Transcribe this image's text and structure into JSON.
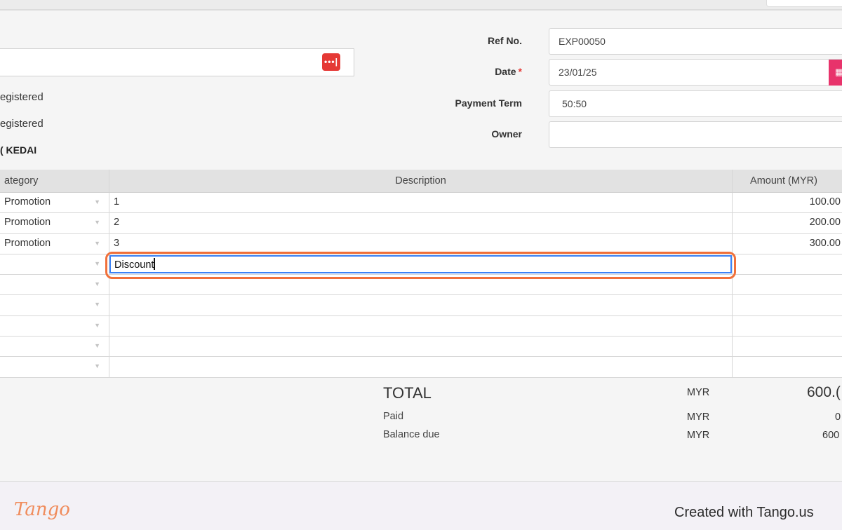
{
  "vendor": {
    "info_line_1": "egistered",
    "info_line_2": "egistered",
    "info_line_3": "( KEDAI",
    "lookup_icon": "more-icon",
    "lookup_label": "•••|"
  },
  "form": {
    "ref_label": "Ref No.",
    "ref_value": "EXP00050",
    "date_label": "Date",
    "date_required": "*",
    "date_value": "23/01/25",
    "term_label": "Payment Term",
    "term_value": "50:50",
    "owner_label": "Owner",
    "owner_value": ""
  },
  "table": {
    "headers": {
      "category": "ategory",
      "description": "Description",
      "amount": "Amount (MYR)"
    },
    "rows": [
      {
        "category": "Promotion",
        "description": "1",
        "amount": "100.00"
      },
      {
        "category": "Promotion",
        "description": "2",
        "amount": "200.00"
      },
      {
        "category": "Promotion",
        "description": "3",
        "amount": "300.00"
      },
      {
        "category": "",
        "description": "Discount",
        "amount": ""
      },
      {
        "category": "",
        "description": "",
        "amount": ""
      },
      {
        "category": "",
        "description": "",
        "amount": ""
      },
      {
        "category": "",
        "description": "",
        "amount": ""
      },
      {
        "category": "",
        "description": "",
        "amount": ""
      },
      {
        "category": "",
        "description": "",
        "amount": ""
      }
    ],
    "editing_value": "Discount"
  },
  "totals": {
    "total_label": "TOTAL",
    "total_currency": "MYR",
    "total_value": "600.(",
    "paid_label": "Paid",
    "paid_currency": "MYR",
    "paid_value": "0",
    "balance_label": "Balance due",
    "balance_currency": "MYR",
    "balance_value": "600"
  },
  "footer": {
    "logo_text": "Tango",
    "created_with": "Created with Tango.us"
  },
  "colors": {
    "highlight": "#f1703a",
    "lookup_button": "#e53935",
    "calendar_button": "#e8336b",
    "focus_border": "#3b82f6"
  }
}
